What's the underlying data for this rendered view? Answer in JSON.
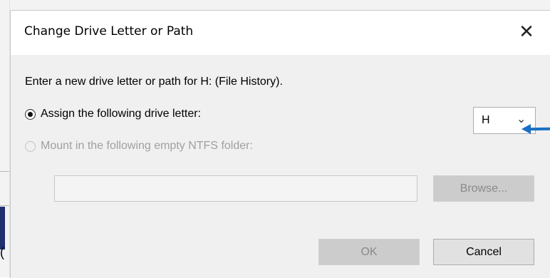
{
  "dialog": {
    "title": "Change Drive Letter or Path",
    "close_glyph": "✕",
    "instruction": "Enter a new drive letter or path for H: (File History).",
    "options": {
      "assign_letter_label": "Assign the following drive letter:",
      "assign_letter_selected": true,
      "mount_folder_label": "Mount in the following empty NTFS folder:",
      "mount_folder_enabled": false
    },
    "drive_letter_select": {
      "value": "H",
      "chevron": "﹀"
    },
    "folder_path_input": {
      "value": ""
    },
    "buttons": {
      "browse": "Browse...",
      "ok": "OK",
      "cancel": "Cancel"
    }
  },
  "background_window": {
    "fragment": "("
  },
  "annotation": {
    "arrow_color": "#1a70c2"
  }
}
